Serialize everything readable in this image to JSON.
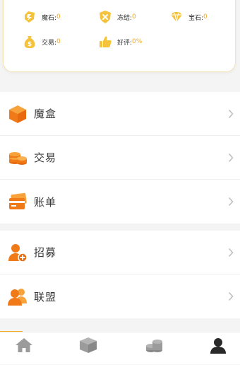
{
  "stats": [
    {
      "label": "魔石:",
      "value": "0",
      "icon": "magic-stone-icon"
    },
    {
      "label": "冻结:",
      "value": "0",
      "icon": "frozen-shield-icon"
    },
    {
      "label": "宝石:",
      "value": "0",
      "icon": "gem-icon"
    },
    {
      "label": "交易:",
      "value": "0",
      "icon": "money-bag-icon"
    },
    {
      "label": "好评:",
      "value": "0%",
      "icon": "thumbs-up-icon"
    }
  ],
  "menu": {
    "group1": [
      {
        "label": "魔盒",
        "icon": "magic-box-icon"
      },
      {
        "label": "交易",
        "icon": "coins-stack-icon"
      },
      {
        "label": "账单",
        "icon": "bill-card-icon"
      }
    ],
    "group2": [
      {
        "label": "招募",
        "icon": "recruit-user-icon"
      },
      {
        "label": "联盟",
        "icon": "alliance-users-icon"
      }
    ]
  },
  "tabbar": {
    "tabs": [
      {
        "icon": "home-icon",
        "label": ""
      },
      {
        "icon": "box-icon",
        "label": ""
      },
      {
        "icon": "coins-icon",
        "label": ""
      },
      {
        "icon": "user-icon",
        "label": ""
      }
    ]
  },
  "colors": {
    "accent": "#f2a81f",
    "icon_orange": "#f07a18",
    "background": "#f4f4f4"
  }
}
